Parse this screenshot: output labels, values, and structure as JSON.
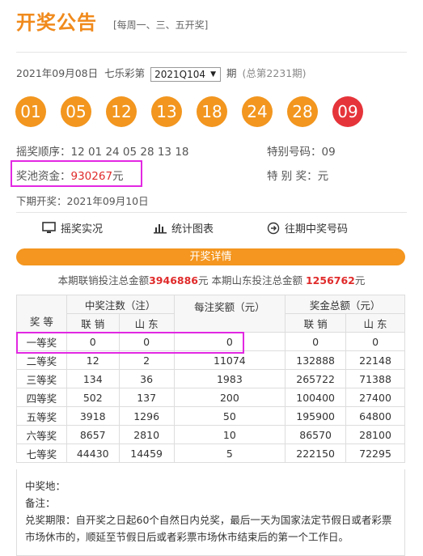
{
  "header": {
    "title": "开奖公告",
    "subtitle": "[每周一、三、五开奖]"
  },
  "draw": {
    "date": "2021年09月08日",
    "lottery_name": "七乐彩第",
    "issue_selected": "2021Q104",
    "issue_suffix": "期",
    "total_label": "(总第2231期)"
  },
  "balls": {
    "regular": [
      "01",
      "05",
      "12",
      "13",
      "18",
      "24",
      "28"
    ],
    "special": "09",
    "colors": {
      "regular": "#f2961f",
      "special": "#e5343a"
    }
  },
  "info": {
    "order_label": "摇奖顺序：",
    "order_value": "12 01 24 05 28 13 18",
    "special_label": "特别号码：",
    "special_value": "09",
    "pool_label": "奖池资金：",
    "pool_value": "930267",
    "pool_unit": "元",
    "special_prize_label": "特 别 奖：",
    "special_prize_value": "元",
    "next_draw_label": "下期开奖：",
    "next_draw_value": "2021年09月10日"
  },
  "links": {
    "live": "摇奖实况",
    "chart": "统计图表",
    "history": "往期中奖号码"
  },
  "detail_bar": "开奖详情",
  "sales": {
    "prefix": "本期联销投注总金额",
    "total": "3946886",
    "mid": "元 本期山东投注总金额",
    "shandong": "1256762",
    "suffix": "元"
  },
  "table": {
    "headers": {
      "count": "中奖注数（注）",
      "per": "每注奖额（元）",
      "total": "奖金总额（元）",
      "level": "奖 等",
      "lianxiao": "联 销",
      "shandong": "山 东"
    },
    "rows": [
      {
        "level": "一等奖",
        "count_lx": "0",
        "count_sd": "0",
        "per": "0",
        "total_lx": "0",
        "total_sd": "0"
      },
      {
        "level": "二等奖",
        "count_lx": "12",
        "count_sd": "2",
        "per": "11074",
        "total_lx": "132888",
        "total_sd": "22148"
      },
      {
        "level": "三等奖",
        "count_lx": "134",
        "count_sd": "36",
        "per": "1983",
        "total_lx": "265722",
        "total_sd": "71388"
      },
      {
        "level": "四等奖",
        "count_lx": "502",
        "count_sd": "137",
        "per": "200",
        "total_lx": "100400",
        "total_sd": "27400"
      },
      {
        "level": "五等奖",
        "count_lx": "3918",
        "count_sd": "1296",
        "per": "50",
        "total_lx": "195900",
        "total_sd": "64800"
      },
      {
        "level": "六等奖",
        "count_lx": "8657",
        "count_sd": "2810",
        "per": "10",
        "total_lx": "86570",
        "total_sd": "28100"
      },
      {
        "level": "七等奖",
        "count_lx": "44430",
        "count_sd": "14459",
        "per": "5",
        "total_lx": "222150",
        "total_sd": "72295"
      }
    ]
  },
  "notes": {
    "location": "中奖地：",
    "remark": "备注：",
    "deadline": "兑奖期限：自开奖之日起60个自然日内兑奖，最后一天为国家法定节假日或者彩票市场休市的，顺延至节假日后或者彩票市场休市结束后的第一个工作日。"
  }
}
